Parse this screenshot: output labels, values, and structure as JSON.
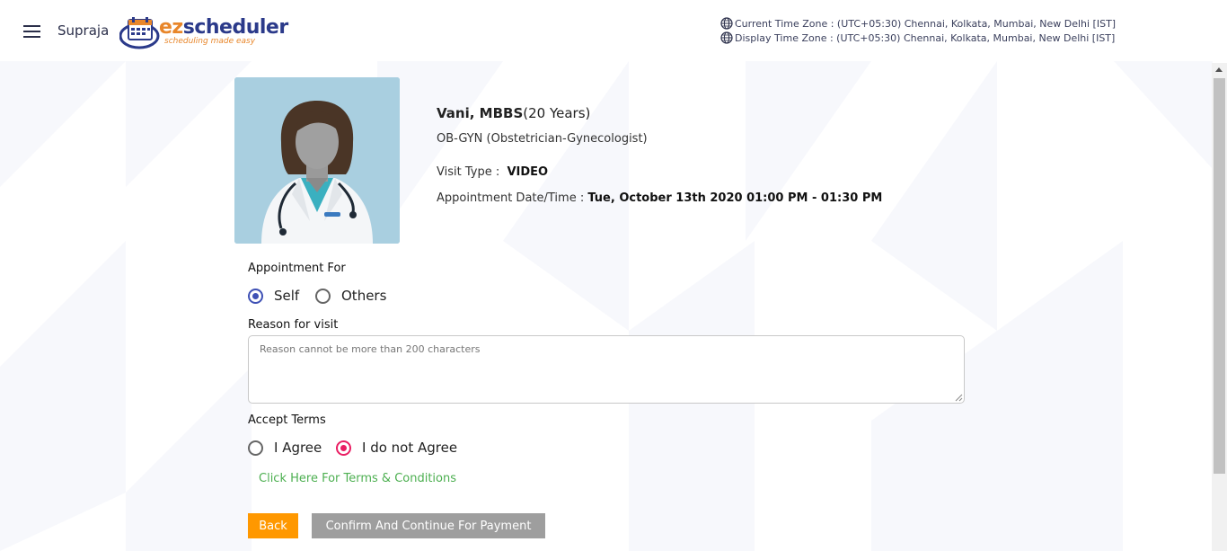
{
  "header": {
    "user_name": "Supraja",
    "logo_text": "ezscheduler",
    "logo_tagline": "scheduling made easy",
    "current_timezone": "Current Time Zone : (UTC+05:30) Chennai, Kolkata, Mumbai, New Delhi [IST]",
    "display_timezone": "Display Time Zone : (UTC+05:30) Chennai, Kolkata, Mumbai, New Delhi [IST]",
    "icons": [
      "menu-icon",
      "globe-icon"
    ]
  },
  "doctor": {
    "name": "Vani, MBBS",
    "experience": "(20 Years)",
    "specialty": "OB-GYN (Obstetrician-Gynecologist)",
    "visit_type_label": "Visit Type :",
    "visit_type": "VIDEO",
    "appointment_label": "Appointment Date/Time :",
    "appointment_value": "Tue, October 13th 2020 01:00 PM - 01:30 PM"
  },
  "form": {
    "appointment_for_label": "Appointment For",
    "option_self": "Self",
    "option_others": "Others",
    "appointment_for_selected": "Self",
    "reason_label": "Reason for visit",
    "reason_value": "",
    "reason_placeholder": "Reason cannot be more than 200 characters",
    "accept_terms_label": "Accept Terms",
    "option_agree": "I Agree",
    "option_disagree": "I do not Agree",
    "terms_selected": "I do not Agree",
    "terms_link": "Click Here For Terms & Conditions"
  },
  "buttons": {
    "back": "Back",
    "confirm": "Confirm And Continue For Payment"
  },
  "colors": {
    "primary_radio": "#3f51b5",
    "accent_radio": "#e91e63",
    "back_button": "#ff9800",
    "confirm_button": "#9e9e9e",
    "link": "#4caf50",
    "doctor_bg": "#a9cfe0"
  }
}
